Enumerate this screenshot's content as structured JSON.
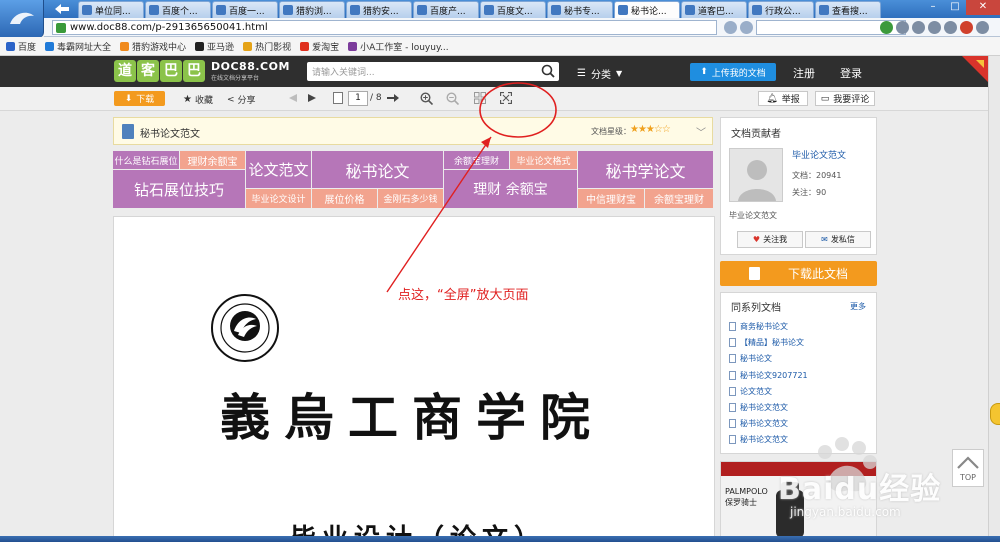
{
  "browser": {
    "tabs": [
      "单位同...",
      "百度个...",
      "百度一...",
      "猎豹浏...",
      "猎豹安...",
      "百度产...",
      "百度文...",
      "秘书专...",
      "秘书论...",
      "道客巴...",
      "行政公...",
      "查看搜..."
    ],
    "active_tab_index": 8,
    "url": "www.doc88.com/p-291365650041.html"
  },
  "bookmarks": [
    {
      "label": "百度",
      "color": "#2a63c8"
    },
    {
      "label": "毒霸网址大全",
      "color": "#1f7ad8"
    },
    {
      "label": "猎豹游戏中心",
      "color": "#f08a1d"
    },
    {
      "label": "亚马逊",
      "color": "#222222"
    },
    {
      "label": "热门影视",
      "color": "#e5a317"
    },
    {
      "label": "爱淘宝",
      "color": "#e0301e"
    },
    {
      "label": "小A工作室 - louyuy...",
      "color": "#7c3c9c"
    }
  ],
  "site": {
    "logo_chars": [
      "道",
      "客",
      "巴",
      "巴"
    ],
    "logo_domain": "DOC88.COM",
    "logo_tagline": "在线文档分享平台",
    "search_placeholder": "请输入关键词...",
    "category_label": "分类",
    "upload_label": "上传我的文档",
    "register_label": "注册",
    "login_label": "登录"
  },
  "toolbar": {
    "download_label": "下载",
    "favorite_label": "收藏",
    "share_label": "分享",
    "current_page": "1",
    "total_pages": "/ 8",
    "report_label": "举报",
    "comment_label": "我要评论"
  },
  "doc": {
    "title": "秘书论文范文",
    "rating_label": "文档星级：",
    "stars": "★★★☆☆",
    "body_title": "義烏工商学院",
    "body_subtitle": "毕业设计（论文）"
  },
  "banner": {
    "cells": [
      "什么是钻石展位",
      "理财余额宝",
      "钻石展位技巧",
      "论文范文",
      "毕业论文设计",
      "秘书论文",
      "展位价格",
      "金刚石多少钱",
      "余额宝理财",
      "毕业论文格式",
      "理财 余额宝",
      "秘书学论文",
      "中信理财宝",
      "余额宝理财"
    ]
  },
  "annotation": {
    "text": "点这，“全屏”放大页面",
    "color": "#e02020"
  },
  "sidebar": {
    "contributor_heading": "文档贡献者",
    "contributor_name": "毕业论文范文",
    "docs_count": "文档：20941",
    "followers": "关注：90",
    "avatar_caption": "毕业论文范文",
    "follow_button": "关注我",
    "message_button": "发私信",
    "download_big_label": "下载此文档",
    "related_heading": "同系列文档",
    "related_more": "更多",
    "related_docs": [
      "商务秘书论文",
      "【精品】秘书论文",
      "秘书论文",
      "秘书论文9207721",
      "论文范文",
      "秘书论文范文",
      "秘书论文范文",
      "秘书论文范文"
    ],
    "ad_brand": "PALMPOLO",
    "ad_brand_cn": "保罗骑士"
  },
  "watermark": {
    "text": "Baidu经验",
    "url": "jingyan.baidu.com"
  },
  "top_button_label": "TOP"
}
